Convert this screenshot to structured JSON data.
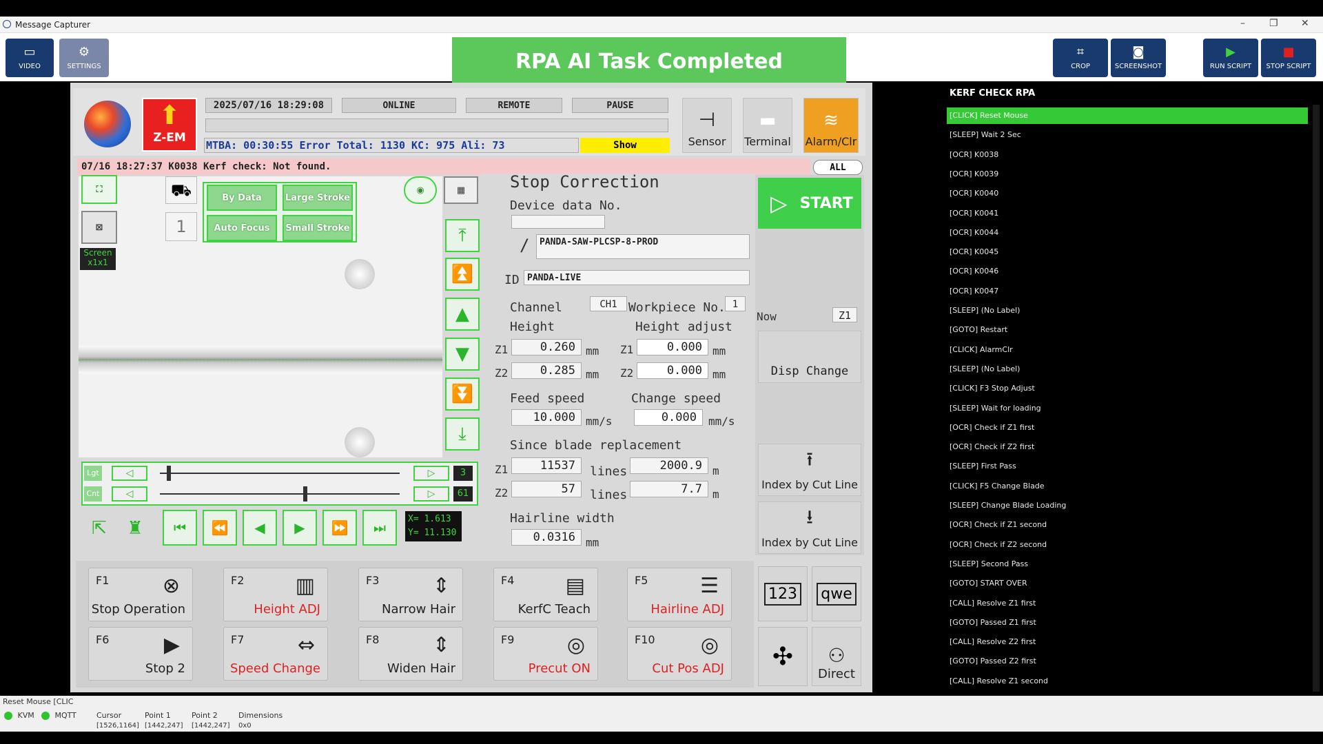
{
  "window": {
    "title": "Message Capturer",
    "min": "–",
    "restore": "❐",
    "close": "✕"
  },
  "toolbar": {
    "video": "VIDEO",
    "settings": "SETTINGS",
    "crop": "CROP",
    "screenshot": "SCREENSHOT",
    "run_script": "RUN SCRIPT",
    "stop_script": "STOP SCRIPT"
  },
  "banner": "RPA AI Task Completed",
  "machine": {
    "logo_label": "Z-EM",
    "datetime": "2025/07/16 18:29:08",
    "status": [
      "ONLINE",
      "REMOTE",
      "PAUSE"
    ],
    "ticker": "MTBA: 00:30:55 Error Total: 1130 KC: 975 Ali: 73",
    "show": "Show",
    "sensor": "Sensor",
    "terminal": "Terminal",
    "alarm": "Alarm/Clr",
    "error": "07/16 18:27:37 K0038  Kerf check: Not found.",
    "all": "ALL"
  },
  "camera": {
    "by_data": "By Data",
    "large_stroke": "Large Stroke",
    "auto_focus": "Auto Focus",
    "small_stroke": "Small Stroke",
    "one": "1",
    "screen": "Screen",
    "screen_sub": "x1x1",
    "slider1_label": "Lgt",
    "slider1_val": "3",
    "slider2_label": "Cnt",
    "slider2_val": "61",
    "x": "X=  1.613",
    "y": "Y= 11.130"
  },
  "panel": {
    "title": "Stop Correction",
    "device_label": "Device data No.",
    "device_value": "PANDA-SAW-PLCSP-8-PROD",
    "id_label": "ID",
    "id_value": "PANDA-LIVE",
    "channel_label": "Channel",
    "channel_value": "CH1",
    "workpiece_label": "Workpiece No.",
    "workpiece_value": "1",
    "height": "Height",
    "height_adjust": "Height adjust",
    "z1": "Z1",
    "z2": "Z2",
    "h_z1": "0.260",
    "h_z2": "0.285",
    "ha_z1": "0.000",
    "ha_z2": "0.000",
    "mm": "mm",
    "feed_speed": "Feed speed",
    "feed_val": "10.000",
    "change_speed": "Change speed",
    "change_val": "0.000",
    "mms": "mm/s",
    "since_blade": "Since blade replacement",
    "lines_z1": "11537",
    "lines_z2": "57",
    "lines": "lines",
    "m_z1": "2000.9",
    "m_z2": "7.7",
    "m": "m",
    "hairline_width": "Hairline width",
    "hairline_val": "0.0316"
  },
  "right_col": {
    "start": "START",
    "now": "Now",
    "now_val": "Z1",
    "disp_change": "Disp Change",
    "index_up": "Index by Cut Line",
    "index_down": "Index by Cut Line",
    "num": "123",
    "qwe": "qwe",
    "direct": "Direct"
  },
  "fkeys": [
    {
      "fn": "F1",
      "label": "Stop Operation",
      "icon": "⊗",
      "red": false
    },
    {
      "fn": "F2",
      "label": "Height ADJ",
      "icon": "▥",
      "red": true
    },
    {
      "fn": "F3",
      "label": "Narrow Hair",
      "icon": "⇕",
      "red": false
    },
    {
      "fn": "F4",
      "label": "KerfC Teach",
      "icon": "▤",
      "red": false
    },
    {
      "fn": "F5",
      "label": "Hairline ADJ",
      "icon": "☰",
      "red": true
    },
    {
      "fn": "F6",
      "label": "Stop 2",
      "icon": "▶",
      "red": false
    },
    {
      "fn": "F7",
      "label": "Speed Change",
      "icon": "⇔",
      "red": true
    },
    {
      "fn": "F8",
      "label": "Widen Hair",
      "icon": "⇕",
      "red": false
    },
    {
      "fn": "F9",
      "label": "Precut ON",
      "icon": "◎",
      "red": true
    },
    {
      "fn": "F10",
      "label": "Cut Pos ADJ",
      "icon": "◎",
      "red": true
    }
  ],
  "rpa": {
    "title": "KERF CHECK RPA",
    "items": [
      "[CLICK] Reset Mouse",
      "[SLEEP] Wait 2 Sec",
      "[OCR] K0038",
      "[OCR] K0039",
      "[OCR] K0040",
      "[OCR] K0041",
      "[OCR] K0044",
      "[OCR] K0045",
      "[OCR] K0046",
      "[OCR] K0047",
      "[SLEEP] (No Label)",
      "[GOTO] Restart",
      "[CLICK] AlarmClr",
      "[SLEEP] (No Label)",
      "[CLICK] F3 Stop Adjust",
      "[SLEEP] Wait for loading",
      "[OCR] Check if Z1 first",
      "[OCR] Check if Z2 first",
      "[SLEEP] First Pass",
      "[CLICK] F5 Change Blade",
      "[SLEEP] Change Blade Loading",
      "[OCR] Check if Z1 second",
      "[OCR] Check if Z2 second",
      "[SLEEP] Second Pass",
      "[GOTO] START OVER",
      "[CALL] Resolve Z1 first",
      "[GOTO] Passed Z1 first",
      "[CALL] Resolve Z2 first",
      "[GOTO] Passed Z2 first",
      "[CALL] Resolve Z1 second"
    ]
  },
  "footer": {
    "status": "Reset Mouse [CLIC",
    "kvm": "KVM",
    "mqtt": "MQTT",
    "cursor_label": "Cursor",
    "cursor_val": "[1526,1164]",
    "p1_label": "Point 1",
    "p1_val": "[1442,247]",
    "p2_label": "Point 2",
    "p2_val": "[1442,247]",
    "dim_label": "Dimensions",
    "dim_val": "0x0"
  },
  "colors": {
    "green": "#5cc85c",
    "navy": "#183a6e",
    "rpa_active": "#35c935"
  }
}
